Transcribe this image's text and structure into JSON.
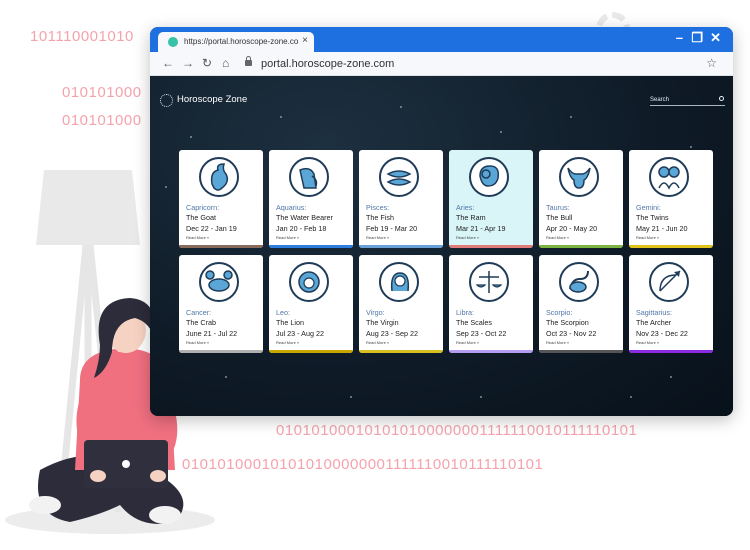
{
  "decor": {
    "binary_lines": [
      "101110001010",
      "010101000",
      "010101000",
      "010101000101010100000001111110010111110101",
      "010101000101010100000001111110010111110101"
    ]
  },
  "browser": {
    "tab_title": "https://portal.horoscope-zone.co",
    "tab_close": "×",
    "window_controls": {
      "minimize": "–",
      "restore": "❐",
      "close": "✕"
    },
    "nav": {
      "back": "←",
      "forward": "→",
      "reload": "↻",
      "home": "⌂",
      "bookmark": "☆"
    },
    "url": "portal.horoscope-zone.com"
  },
  "site": {
    "name": "Horoscope Zone",
    "search_label": "Search"
  },
  "cards": [
    {
      "sign": "Capricorn:",
      "name": "The Goat",
      "dates": "Dec 22 - Jan 19",
      "read_more": "Read More »",
      "color": "#8a6a5a",
      "icon": "goat-icon",
      "highlight": false
    },
    {
      "sign": "Aquarius:",
      "name": "The Water Bearer",
      "dates": "Jan 20 - Feb 18",
      "read_more": "Read More »",
      "color": "#2e7de0",
      "icon": "water-bearer-icon",
      "highlight": false
    },
    {
      "sign": "Pisces:",
      "name": "The Fish",
      "dates": "Feb 19 - Mar 20",
      "read_more": "Read More »",
      "color": "#6aa0d8",
      "icon": "fish-icon",
      "highlight": false
    },
    {
      "sign": "Aries:",
      "name": "The Ram",
      "dates": "Mar 21 - Apr 19",
      "read_more": "Read More »",
      "color": "#e07b7b",
      "icon": "ram-icon",
      "highlight": true
    },
    {
      "sign": "Taurus:",
      "name": "The Bull",
      "dates": "Apr 20 - May 20",
      "read_more": "Read More »",
      "color": "#7cb342",
      "icon": "bull-icon",
      "highlight": false
    },
    {
      "sign": "Gemini:",
      "name": "The Twins",
      "dates": "May 21 - Jun 20",
      "read_more": "Read More »",
      "color": "#e0c21a",
      "icon": "twins-icon",
      "highlight": false
    },
    {
      "sign": "Cancer:",
      "name": "The Crab",
      "dates": "June 21 - Jul 22",
      "read_more": "Read More »",
      "color": "#b0b0b0",
      "icon": "crab-icon",
      "highlight": false
    },
    {
      "sign": "Leo:",
      "name": "The Lion",
      "dates": "Jul 23 - Aug 22",
      "read_more": "Read More »",
      "color": "#c8a800",
      "icon": "lion-icon",
      "highlight": false
    },
    {
      "sign": "Virgo:",
      "name": "The Virgin",
      "dates": "Aug 23 - Sep 22",
      "read_more": "Read More »",
      "color": "#d6c020",
      "icon": "virgin-icon",
      "highlight": false
    },
    {
      "sign": "Libra:",
      "name": "The Scales",
      "dates": "Sep 23 - Oct 22",
      "read_more": "Read More »",
      "color": "#b49cf0",
      "icon": "scales-icon",
      "highlight": false
    },
    {
      "sign": "Scorpio:",
      "name": "The Scorpion",
      "dates": "Oct 23 - Nov 22",
      "read_more": "Read More »",
      "color": "#555555",
      "icon": "scorpion-icon",
      "highlight": false
    },
    {
      "sign": "Sagittarius:",
      "name": "The Archer",
      "dates": "Nov 23 - Dec 22",
      "read_more": "Read More »",
      "color": "#8a2be2",
      "icon": "archer-icon",
      "highlight": false
    }
  ],
  "colors": {
    "accent": "#1e6fe0",
    "binary": "#f4a3ad",
    "icon_outline": "#1f3b57",
    "icon_fill": "#5aa6d6"
  }
}
